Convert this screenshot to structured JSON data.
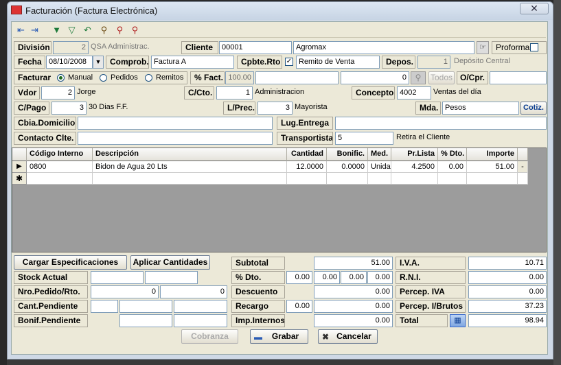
{
  "window": {
    "title": "Facturación  (Factura Electrónica)",
    "close": "✕"
  },
  "toolbar": [
    "nav-first-icon",
    "nav-last-icon",
    "filter-icon",
    "filter-remove-icon",
    "undo-icon",
    "search-icon",
    "zoom-icon",
    "zoom-alt-icon"
  ],
  "header": {
    "division_label": "División",
    "division_code": "2",
    "division_name": "QSA Administrac.",
    "cliente_label": "Cliente",
    "cliente_code": "00001",
    "cliente_name": "Agromax",
    "proforma_label": "Proforma",
    "fecha_label": "Fecha",
    "fecha_value": "08/10/2008",
    "comprob_label": "Comprob.",
    "comprob_value": "Factura  A",
    "cpbte_rto_label": "Cpbte.Rto",
    "cpbte_rto_value": "Remito de Venta",
    "cpbte_rto_checked": "✓",
    "depos_label": "Depos.",
    "depos_code": "1",
    "depos_name": "Depósito Central",
    "facturar_label": "Facturar",
    "opt_manual": "Manual",
    "opt_pedidos": "Pedidos",
    "opt_remitos": "Remitos",
    "pct_fact_label": "% Fact.",
    "pct_fact_value": "100.00",
    "zero_value": "0",
    "todos_label": "Todos",
    "ocpr_label": "O/Cpr.",
    "vdor_label": "Vdor",
    "vdor_code": "2",
    "vdor_name": "Jorge",
    "ccto_label": "C/Cto.",
    "ccto_code": "1",
    "ccto_name": "Administracion",
    "concepto_label": "Concepto",
    "concepto_code": "4002",
    "concepto_name": "Ventas del día",
    "cpago_label": "C/Pago",
    "cpago_code": "3",
    "cpago_name": "30 Dias F.F.",
    "lprec_label": "L/Prec.",
    "lprec_code": "3",
    "lprec_name": "Mayorista",
    "mda_label": "Mda.",
    "mda_value": "Pesos",
    "cotiz_label": "Cotiz.",
    "cbia_label": "Cbia.Domicilio",
    "lug_label": "Lug.Entrega",
    "contacto_label": "Contacto Clte.",
    "transp_label": "Transportista",
    "transp_code": "5",
    "transp_name": "Retira el Cliente"
  },
  "grid": {
    "columns": [
      "Código Interno",
      "Descripción",
      "Cantidad",
      "Bonific.",
      "Med.",
      "Pr.Lista",
      "% Dto.",
      "Importe"
    ],
    "rows": [
      [
        "0800",
        "Bidon de Agua 20 Lts",
        "12.0000",
        "0.0000",
        "Unida",
        "4.2500",
        "0.00",
        "51.00"
      ]
    ],
    "row_marker": "▶",
    "new_marker": "✱",
    "row_btn": "-"
  },
  "footer": {
    "cargar": "Cargar Especificaciones",
    "aplicar": "Aplicar Cantidades",
    "stock": "Stock Actual",
    "nro_ped": "Nro.Pedido/Rto.",
    "nro_ped_a": "0",
    "nro_ped_b": "0",
    "cant_pend": "Cant.Pendiente",
    "bonif_pend": "Bonif.Pendiente",
    "subtotal_label": "Subtotal",
    "subtotal": "51.00",
    "dto_label": "% Dto.",
    "dto1": "0.00",
    "dto2": "0.00",
    "dto3": "0.00",
    "dto4": "0.00",
    "descuento_label": "Descuento",
    "descuento": "0.00",
    "recargo_label": "Recargo",
    "recargo_pct": "0.00",
    "recargo": "0.00",
    "imp_label": "Imp.Internos",
    "imp": "0.00",
    "iva_label": "I.V.A.",
    "iva": "10.71",
    "rni_label": "R.N.I.",
    "rni": "0.00",
    "perc_iva_label": "Percep. IVA",
    "perc_iva": "0.00",
    "perc_ib_label": "Percep. I/Brutos",
    "perc_ib": "37.23",
    "total_label": "Total",
    "total": "98.94",
    "cobranza": "Cobranza",
    "grabar": "Grabar",
    "cancelar": "Cancelar"
  },
  "colors": {
    "accent": "#0b3d91",
    "window_bg": "#ece9d8"
  }
}
